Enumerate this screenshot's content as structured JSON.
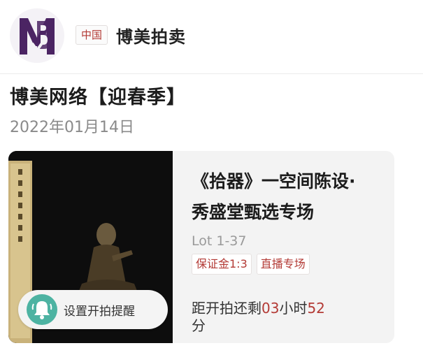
{
  "header": {
    "logo_icon": "bm-monogram-logo",
    "region": "中国",
    "brand_name": "博美拍卖"
  },
  "page": {
    "title": "博美网络【迎春季】",
    "date": "2022年01月14日"
  },
  "auction_card": {
    "image_icon": "bronze-buddha-figure-photo",
    "remind_icon": "bell-icon",
    "remind_label": "设置开拍提醒",
    "title": "《拾器》一空间陈设·秀盛堂甄选专场",
    "lot_range": "Lot 1-37",
    "tags": [
      "保证金1:3",
      "直播专场"
    ],
    "countdown": {
      "prefix": "距开拍还剩",
      "hours": "03",
      "hours_unit": "小时",
      "minutes": "52",
      "minutes_unit": "分"
    }
  },
  "colors": {
    "accent_red": "#b33a35",
    "bell_teal": "#4db3a2",
    "logo_purple": "#4b2463"
  }
}
